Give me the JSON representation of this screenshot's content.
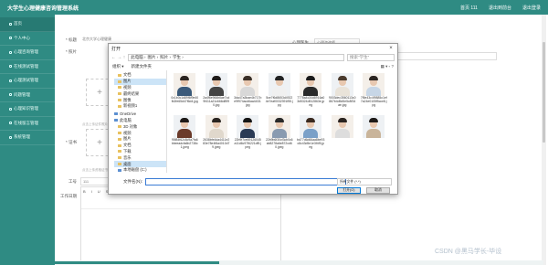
{
  "app": {
    "title": "大学生心理健康咨询管理系统",
    "header_links": [
      "首页 111",
      "退出到前台",
      "退出登录"
    ]
  },
  "sidebar": {
    "items": [
      {
        "label": "首页"
      },
      {
        "label": "个人中心"
      },
      {
        "label": "心理咨询管理"
      },
      {
        "label": "在线测试管理"
      },
      {
        "label": "心理测试管理"
      },
      {
        "label": "问题管理"
      },
      {
        "label": "心理知识管理"
      },
      {
        "label": "在线留言管理"
      },
      {
        "label": "系统管理"
      }
    ]
  },
  "form": {
    "name_label": "* 标题",
    "name_value": "北京大学心理健康",
    "photo_label": "* 照片",
    "license_label": "* 证书",
    "phone_label": "工号",
    "phone_value": "111",
    "content_label": "工作日期",
    "upload_hint1": "点击上传证件照片",
    "upload_hint2": "点击上传资格证书",
    "right_label1": "心理医生",
    "right_value1": "心理咨询师",
    "right_label2": "心理医生"
  },
  "editor": {
    "toolbar_items": [
      "B",
      "I",
      "U",
      "S",
      "“”",
      "<>",
      "H1",
      "H2",
      "12px",
      "文字",
      "A",
      "A",
      "≡",
      "段落设置"
    ]
  },
  "dialog": {
    "title": "打开",
    "close": "×",
    "path": [
      "此电脑",
      "图片",
      "照片",
      "学生"
    ],
    "search_placeholder": "搜索\"学生\"",
    "organize": "组织 ▾",
    "new_folder": "新建文件夹",
    "nav_items": [
      {
        "label": "文档",
        "sel": false,
        "pc": false,
        "grp": false
      },
      {
        "label": "图片",
        "sel": true,
        "pc": false,
        "grp": false
      },
      {
        "label": "视频",
        "sel": false,
        "pc": false,
        "grp": false
      },
      {
        "label": "最终结果",
        "sel": false,
        "pc": false,
        "grp": false
      },
      {
        "label": "图像",
        "sel": false,
        "pc": false,
        "grp": false
      },
      {
        "label": "新视频1",
        "sel": false,
        "pc": false,
        "grp": false
      },
      {
        "label": "OneDrive",
        "sel": false,
        "pc": true,
        "grp": true
      },
      {
        "label": "此电脑",
        "sel": false,
        "pc": true,
        "grp": true
      },
      {
        "label": "3D 对象",
        "sel": false,
        "pc": false,
        "grp": false
      },
      {
        "label": "视频",
        "sel": false,
        "pc": false,
        "grp": false
      },
      {
        "label": "图片",
        "sel": false,
        "pc": false,
        "grp": false
      },
      {
        "label": "文档",
        "sel": false,
        "pc": false,
        "grp": false
      },
      {
        "label": "下载",
        "sel": false,
        "pc": false,
        "grp": false
      },
      {
        "label": "音乐",
        "sel": false,
        "pc": false,
        "grp": false
      },
      {
        "label": "桌面",
        "sel": true,
        "pc": false,
        "grp": false
      },
      {
        "label": "本地磁盘 (C:)",
        "sel": false,
        "pc": true,
        "grp": false
      }
    ],
    "files": [
      {
        "name": "0c1b0c1d89f6f9e40fb2fe65d47f6d4.jpg",
        "body": "#3b5a7a",
        "hair": "#2b2420"
      },
      {
        "name": "2a4f6e966b6ae7cd9f411a21c666d8990.jpg",
        "body": "#444",
        "hair": "#1e1a18"
      },
      {
        "name": "3da47a3bae4b717be9f974acd6aa4433.jpg",
        "body": "#d8d8d8",
        "hair": "#3a2f26"
      },
      {
        "name": "5ce7f6d8653d49224e7eaf0032391f55.jpg",
        "body": "#f0f0f0",
        "hair": "#222"
      },
      {
        "name": "7778a4c34d8916a03d5324d512863e.jpeg",
        "body": "#2a2a2a",
        "hair": "#1a1a1a"
      },
      {
        "name": "9003dec3560113c0867b4d5d5e5c8f34ae.jpg",
        "body": "#e9e3d9",
        "hair": "#4a3a2c"
      },
      {
        "name": "7f5e43c4f9885c1ef7a24e0105f5cce8.jpg",
        "body": "#c7d6e6",
        "hair": "#2b2420"
      },
      {
        "name": "95f84f62c8c9a7fa6bbeeadcfa6b2738c1.jpeg",
        "body": "#6a3a2a",
        "hair": "#1e1a18"
      },
      {
        "name": "2638bfe4da4411e283e78e4f6a4010d79.jpeg",
        "body": "#e0d8cc",
        "hair": "#2a2420"
      },
      {
        "name": "22b9f7ce69126045a11d6c97f6221df5.jpeg",
        "body": "#2b3b55",
        "hair": "#151515"
      },
      {
        "name": "22b9b6f30cf3cb0c6ab8278a6e872cd60.jpeg",
        "body": "#8a9bb0",
        "hair": "#2a2a2a"
      },
      {
        "name": "bd77d6d66aa8be93c8c43d5e1e3f4f5.jpeg",
        "body": "#7aa0c8",
        "hair": "#3a2a20"
      },
      {
        "name": "",
        "body": "#ddd",
        "hair": "#2b2420"
      },
      {
        "name": "",
        "body": "#c9b49a",
        "hair": "#1e1a18"
      }
    ],
    "filename_label": "文件名(N):",
    "filter_value": "所有文件 (*.*)",
    "open_button": "打开(O)",
    "cancel_button": "取消"
  },
  "watermark": "CSDN @黑马学长-毕设"
}
